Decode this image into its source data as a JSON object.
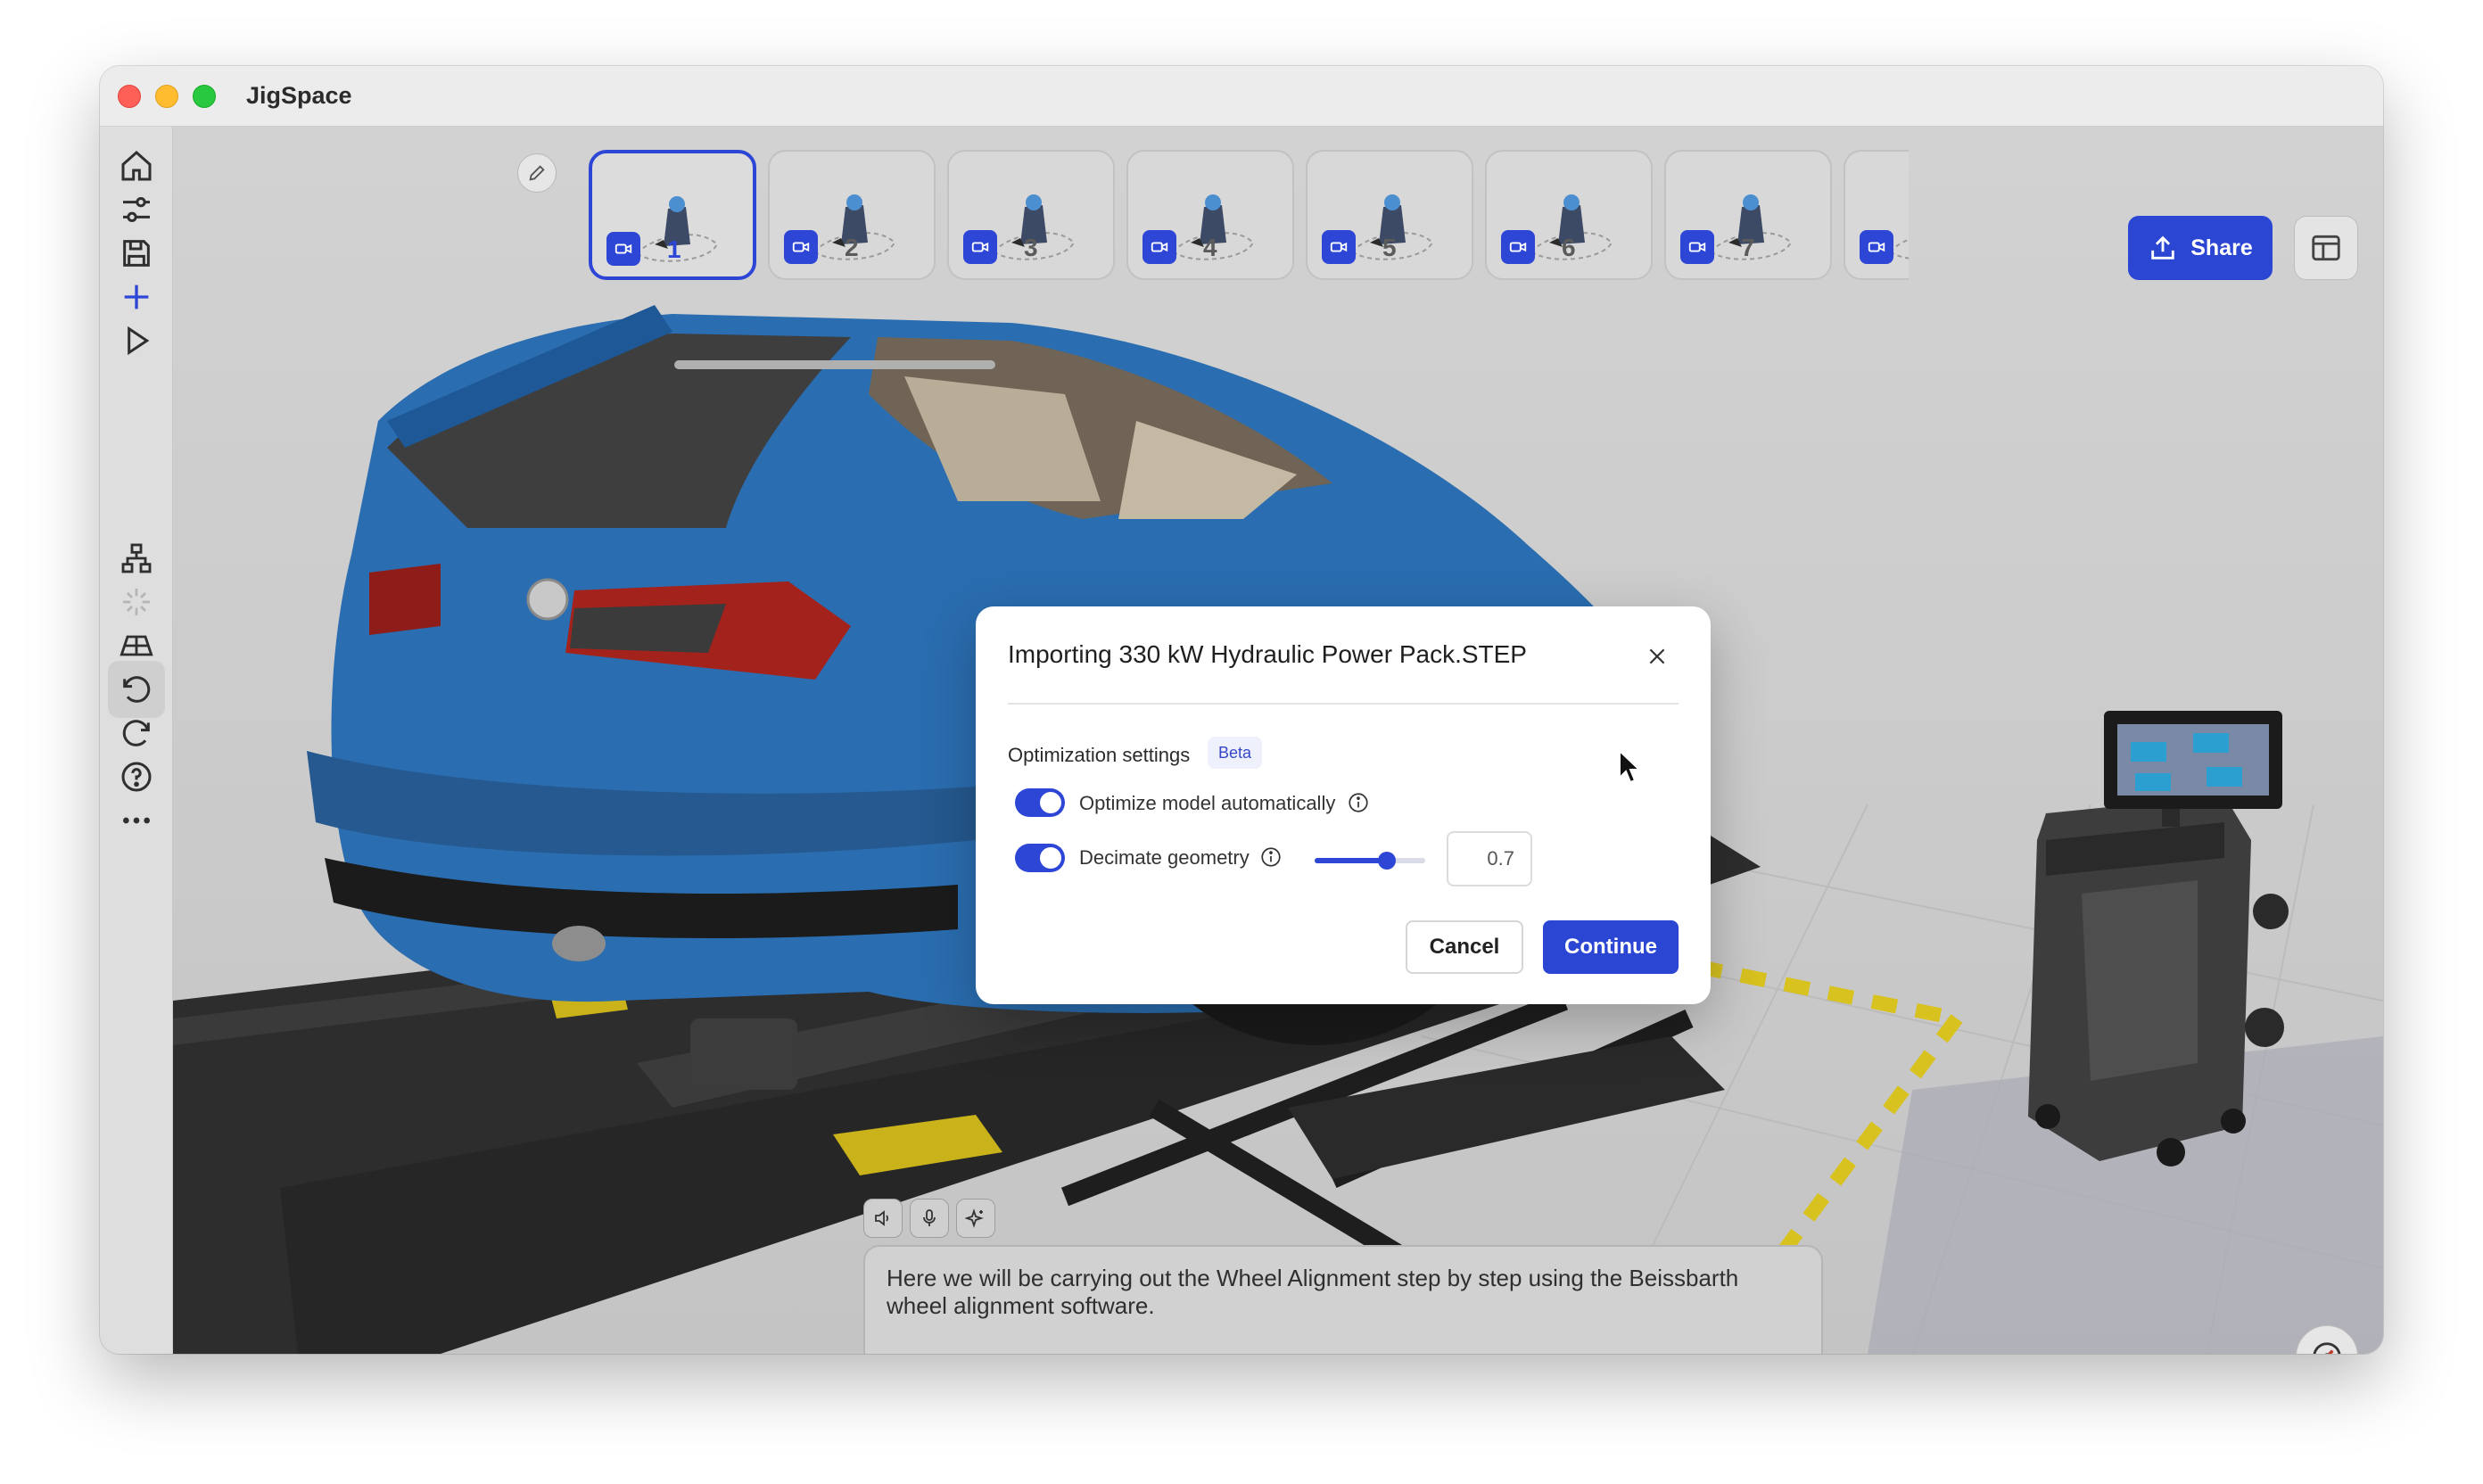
{
  "window": {
    "title": "JigSpace"
  },
  "sidebar": {
    "items": [
      {
        "name": "home",
        "icon": "home-icon"
      },
      {
        "name": "adjust",
        "icon": "sliders-icon"
      },
      {
        "name": "save",
        "icon": "save-icon"
      },
      {
        "name": "add",
        "icon": "plus-icon"
      },
      {
        "name": "play",
        "icon": "play-icon"
      },
      {
        "name": "hierarchy",
        "icon": "hierarchy-icon"
      },
      {
        "name": "effects",
        "icon": "sparkle-disabled-icon"
      },
      {
        "name": "floor",
        "icon": "floor-grid-icon"
      },
      {
        "name": "undo",
        "icon": "undo-icon"
      },
      {
        "name": "redo",
        "icon": "redo-icon"
      },
      {
        "name": "help",
        "icon": "help-icon"
      },
      {
        "name": "more",
        "icon": "more-icon"
      }
    ]
  },
  "steps": {
    "items": [
      {
        "label": "1",
        "active": true
      },
      {
        "label": "2"
      },
      {
        "label": "3"
      },
      {
        "label": "4"
      },
      {
        "label": "5"
      },
      {
        "label": "6"
      },
      {
        "label": "7"
      },
      {
        "label": ""
      }
    ]
  },
  "toolbar": {
    "share_label": "Share"
  },
  "narration": {
    "text": "Here we will be carrying out the Wheel Alignment step by step using the Beissbarth wheel alignment software."
  },
  "modal": {
    "title": "Importing 330 kW Hydraulic Power Pack.STEP",
    "section_label": "Optimization settings",
    "badge": "Beta",
    "optimize_label": "Optimize model automatically",
    "optimize_on": true,
    "decimate_label": "Decimate geometry",
    "decimate_on": true,
    "decimate_value": "0.7",
    "decimate_level": 0.7,
    "cancel_label": "Cancel",
    "continue_label": "Continue"
  },
  "colors": {
    "accent": "#2c46d4",
    "car_blue": "#2a6db0",
    "lift_dark": "#2b2b2b",
    "warning_yellow": "#d8c21f"
  }
}
